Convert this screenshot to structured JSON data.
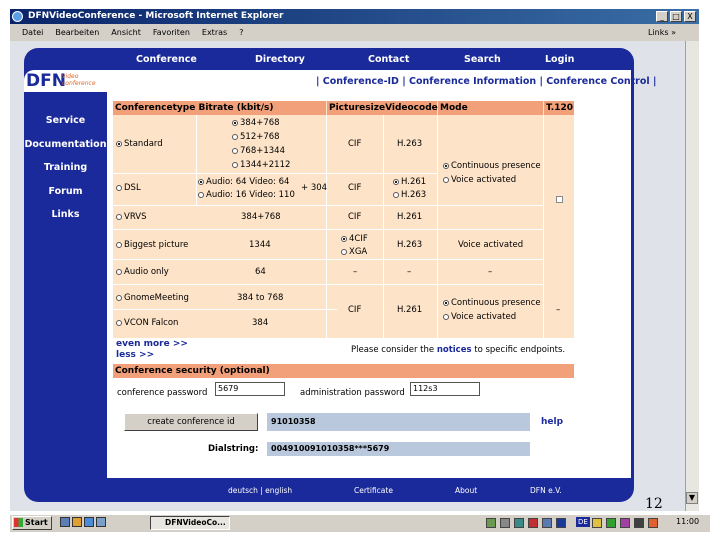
{
  "window": {
    "title": "DFNVideoConference - Microsoft Internet Explorer",
    "min": "_",
    "max": "□",
    "close": "X"
  },
  "menu": {
    "items": [
      "Datei",
      "Bearbeiten",
      "Ansicht",
      "Favoriten",
      "Extras",
      "?"
    ],
    "links": "Links »"
  },
  "topnav": [
    "Conference",
    "Directory",
    "Contact",
    "Search",
    "Login"
  ],
  "logo": {
    "main": "DFN",
    "sub": "video conference"
  },
  "sidenav": [
    "Service",
    "Documentation",
    "Training",
    "Forum",
    "Links"
  ],
  "subnav": "| Conference-ID | Conference Information | Conference Control |",
  "table": {
    "headers": [
      "Conferencetype",
      "Bitrate (kbit/s)",
      "Picturesize",
      "Videocodec",
      "Mode",
      "T.120"
    ],
    "standard": {
      "label": "Standard",
      "bitrates": [
        "384+768",
        "512+768",
        "768+1344",
        "1344+2112"
      ],
      "picture": "CIF",
      "codec": "H.263"
    },
    "dsl": {
      "label": "DSL",
      "opt1": "Audio: 64 Video: 64",
      "opt2": "Audio: 16 Video: 110",
      "plus": "+ 304",
      "picture": "CIF",
      "codec1": "H.261",
      "codec2": "H.263"
    },
    "mode_top": [
      "Continuous presence",
      "Voice activated"
    ],
    "vrvs": {
      "label": "VRVS",
      "bitrate": "384+768",
      "picture": "CIF",
      "codec": "H.261"
    },
    "biggest": {
      "label": "Biggest picture",
      "bitrate": "1344",
      "pic1": "4CIF",
      "pic2": "XGA",
      "codec": "H.263",
      "mode": "Voice activated"
    },
    "audio": {
      "label": "Audio only",
      "bitrate": "64",
      "picture": "–",
      "codec": "–",
      "mode": "–"
    },
    "gnome": {
      "label": "GnomeMeeting",
      "bitrate": "384 to 768"
    },
    "vcon": {
      "label": "VCON Falcon",
      "bitrate": "384"
    },
    "bottom": {
      "picture": "CIF",
      "codec": "H.261",
      "modes": [
        "Continuous presence",
        "Voice activated"
      ],
      "t120": "–"
    }
  },
  "more": "even more >>",
  "less": "less >>",
  "notice": {
    "prefix": "Please consider the",
    "link": "notices",
    "suffix": "to specific endpoints."
  },
  "security": {
    "title": "Conference security (optional)",
    "conf_label": "conference password",
    "conf_value": "5679",
    "admin_label": "administration password",
    "admin_value": "112s3"
  },
  "create": {
    "button": "create conference id",
    "id": "91010358",
    "help": "help",
    "dial_label": "Dialstring:",
    "dial_value": "004910091010358***5679"
  },
  "footer": {
    "lang": "deutsch | english",
    "cert": "Certificate",
    "about": "About",
    "dfn": "DFN e.V."
  },
  "page_number": "12",
  "taskbar": {
    "start": "Start",
    "item": "DFNVideoCo...",
    "clock": "11:00",
    "lang": "DE"
  }
}
